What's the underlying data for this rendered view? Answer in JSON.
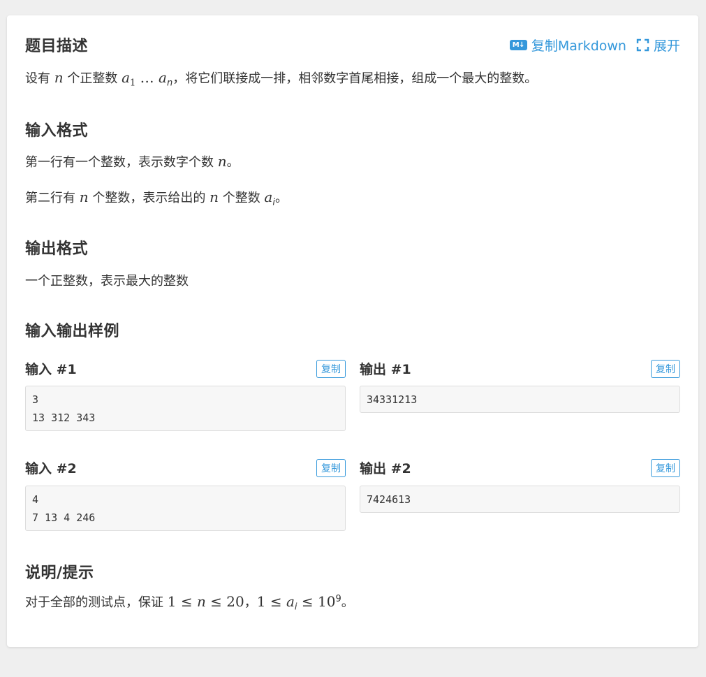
{
  "toolbar": {
    "md_icon": "M↓",
    "copy_markdown": "复制Markdown",
    "expand": "展开"
  },
  "description": {
    "heading": "题目描述",
    "t1": "设有 ",
    "m1": "n",
    "t2": " 个正整数 ",
    "a1_base": "a",
    "a1_sub": "1",
    "dots": " … ",
    "an_base": "a",
    "an_sub": "n",
    "t3": "，将它们联接成一排，相邻数字首尾相接，组成一个最大的整数。"
  },
  "input_format": {
    "heading": "输入格式",
    "line1_text": "第一行有一个整数，表示数字个数 ",
    "line1_math": "n",
    "line1_end": "。",
    "line2_t1": "第二行有 ",
    "line2_m1": "n",
    "line2_t2": " 个整数，表示给出的 ",
    "line2_m2": "n",
    "line2_t3": " 个整数 ",
    "line2_ai_base": "a",
    "line2_ai_sub": "i",
    "line2_end": "。"
  },
  "output_format": {
    "heading": "输出格式",
    "line1": "一个正整数，表示最大的整数"
  },
  "samples": {
    "heading": "输入输出样例",
    "copy_label": "复制",
    "input1_title": "输入 #1",
    "input1_code": "3\n13 312 343",
    "output1_title": "输出 #1",
    "output1_code": "34331213",
    "input2_title": "输入 #2",
    "input2_code": "4\n7 13 4 246",
    "output2_title": "输出 #2",
    "output2_code": "7424613"
  },
  "hint": {
    "heading": "说明/提示",
    "t1": "对于全部的测试点，保证 ",
    "m1": "1 ≤ ",
    "m1_var": "n",
    "m1_rest": " ≤ 20",
    "sep": "，",
    "m2": "1 ≤ ",
    "m2_base": "a",
    "m2_sub": "i",
    "m2_rest": " ≤ 10",
    "m2_exp": "9",
    "end": "。"
  },
  "colors": {
    "accent": "#3498db",
    "page_bg": "#efefef",
    "card_bg": "#ffffff",
    "code_bg": "#f7f7f7"
  }
}
